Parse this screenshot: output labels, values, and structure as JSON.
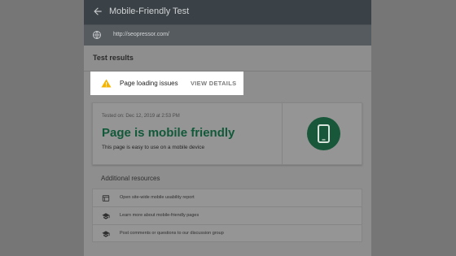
{
  "appbar": {
    "title": "Mobile-Friendly Test",
    "back_icon": "arrow-back-icon"
  },
  "urlbar": {
    "url": "http://seopressor.com/",
    "icon": "globe-icon"
  },
  "results": {
    "heading": "Test results"
  },
  "issue_banner": {
    "icon": "warning-icon",
    "label": "Page loading issues",
    "action": "VIEW DETAILS"
  },
  "result_card": {
    "tested_on": "Tested on: Dec 12, 2019 at 2:53 PM",
    "title": "Page is mobile friendly",
    "subtitle": "This page is easy to use on a mobile device",
    "badge_icon": "smartphone-icon"
  },
  "resources": {
    "heading": "Additional resources",
    "items": [
      {
        "label": "Open site-wide mobile usability report",
        "icon": "report-icon"
      },
      {
        "label": "Learn more about mobile-friendly pages",
        "icon": "school-icon"
      },
      {
        "label": "Post comments or questions to our discussion group",
        "icon": "school-icon"
      }
    ]
  },
  "colors": {
    "appbar": "#3b4247",
    "success": "#12593a",
    "warning": "#f4b400"
  }
}
